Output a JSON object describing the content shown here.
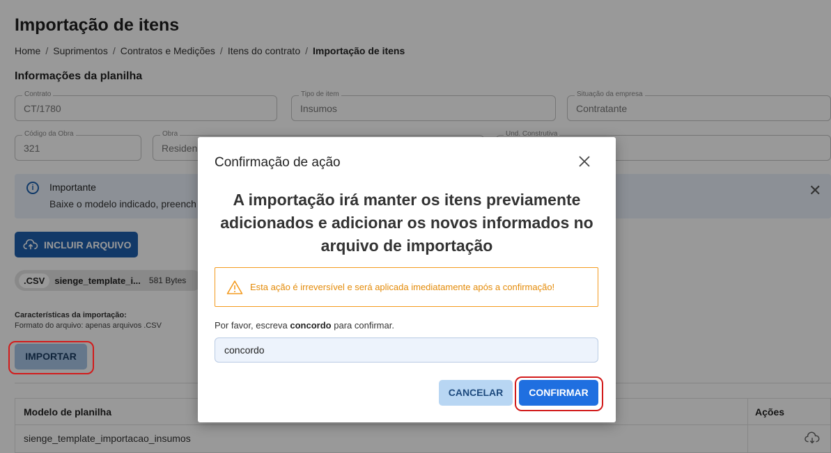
{
  "page": {
    "title": "Importação de itens",
    "breadcrumb": [
      "Home",
      "Suprimentos",
      "Contratos e Medições",
      "Itens do contrato",
      "Importação de itens"
    ],
    "section_title": "Informações da planilha"
  },
  "fields": {
    "contrato": {
      "label": "Contrato",
      "value": "CT/1780"
    },
    "tipo_item": {
      "label": "Tipo de item",
      "value": "Insumos"
    },
    "situacao_empresa": {
      "label": "Situação da empresa",
      "value": "Contratante"
    },
    "codigo_obra": {
      "label": "Código da Obra",
      "value": "321"
    },
    "obra": {
      "label": "Obra",
      "value": "Residen"
    },
    "und_construtiva": {
      "label": "Und. Construtiva",
      "value": ""
    }
  },
  "alert": {
    "title": "Importante",
    "text": "Baixe o modelo indicado, preench",
    "icon": "info-icon"
  },
  "upload_button": {
    "label": "INCLUIR ARQUIVO",
    "icon": "cloud-upload-icon"
  },
  "file_chip": {
    "ext": ".CSV",
    "name": "sienge_template_i...",
    "size": "581 Bytes"
  },
  "characteristics": {
    "title": "Características da importação:",
    "text": "Formato do arquivo: apenas arquivos .CSV"
  },
  "import_button": {
    "label": "IMPORTAR"
  },
  "table": {
    "headers": [
      "Modelo de planilha",
      "Ações"
    ],
    "rows": [
      {
        "name": "sienge_template_importacao_insumos"
      }
    ]
  },
  "modal": {
    "title": "Confirmação de ação",
    "headline": "A importação irá manter os itens previamente adicionados e adicionar os novos informados no arquivo de importação",
    "warning": "Esta ação é irreversível e será aplicada imediatamente após a confirmação!",
    "instruction_prefix": "Por favor, escreva ",
    "instruction_keyword": "concordo",
    "instruction_suffix": " para confirmar.",
    "input_value": "concordo",
    "cancel_label": "CANCELAR",
    "confirm_label": "CONFIRMAR"
  },
  "colors": {
    "primary": "#1e5fad",
    "confirm": "#1f6fe0",
    "warning": "#f39a1e",
    "highlight": "#d21b1b"
  }
}
